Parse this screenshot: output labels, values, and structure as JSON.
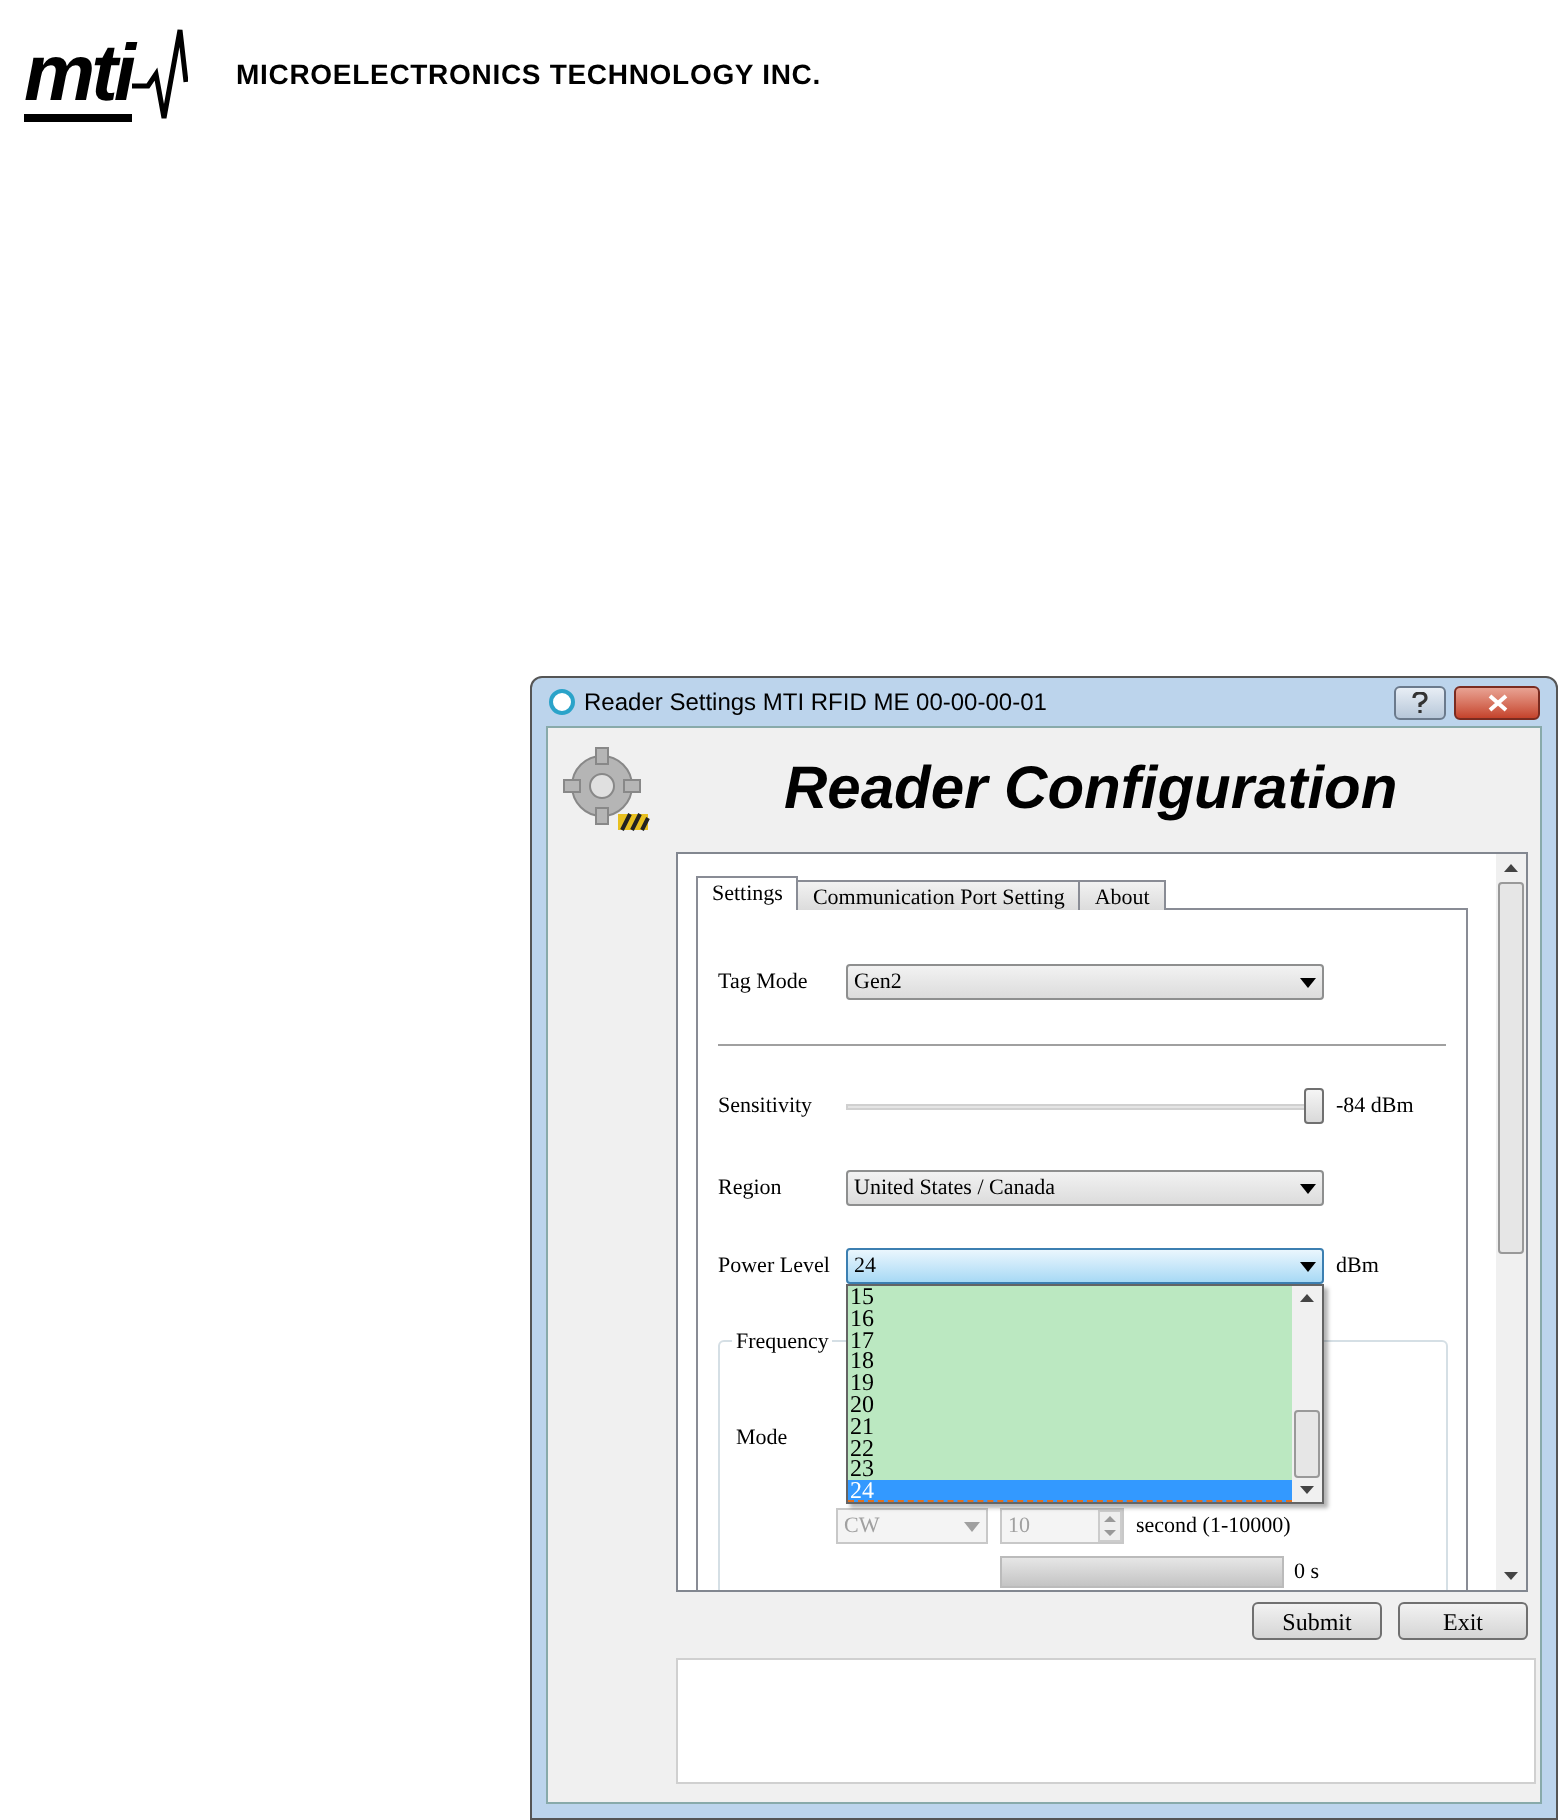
{
  "header": {
    "logo_text": "mti",
    "company": "MICROELECTRONICS TECHNOLOGY INC."
  },
  "window": {
    "title": "Reader Settings MTI RFID ME 00-00-00-01",
    "heading": "Reader Configuration"
  },
  "tabs": [
    {
      "label": "Settings",
      "selected": true
    },
    {
      "label": "Communication Port Setting",
      "selected": false
    },
    {
      "label": "About",
      "selected": false
    }
  ],
  "tag_mode": {
    "label": "Tag Mode",
    "value": "Gen2"
  },
  "sensitivity": {
    "label": "Sensitivity",
    "level": 1,
    "reading": "-84 dBm"
  },
  "region": {
    "label": "Region",
    "value": "United States / Canada"
  },
  "power_level": {
    "label": "Power Level",
    "value": "24",
    "unit": "dBm",
    "expanded": true,
    "options": [
      {
        "label": "15",
        "selected": false
      },
      {
        "label": "16",
        "selected": false
      },
      {
        "label": "17",
        "selected": false
      },
      {
        "label": "18",
        "selected": false
      },
      {
        "label": "19",
        "selected": false
      },
      {
        "label": "20",
        "selected": false
      },
      {
        "label": "21",
        "selected": false
      },
      {
        "label": "22",
        "selected": false
      },
      {
        "label": "23",
        "selected": false
      },
      {
        "label": "24",
        "selected": true
      }
    ]
  },
  "frequency": {
    "title": "Frequency",
    "mode_label": "Mode",
    "mode_value": "CW",
    "mode_disabled": true,
    "duration_value": "10",
    "duration_disabled": true,
    "duration_unit": "second (1-10000)",
    "elapsed": "0 s"
  },
  "buttons": [
    "Submit",
    "Exit"
  ]
}
